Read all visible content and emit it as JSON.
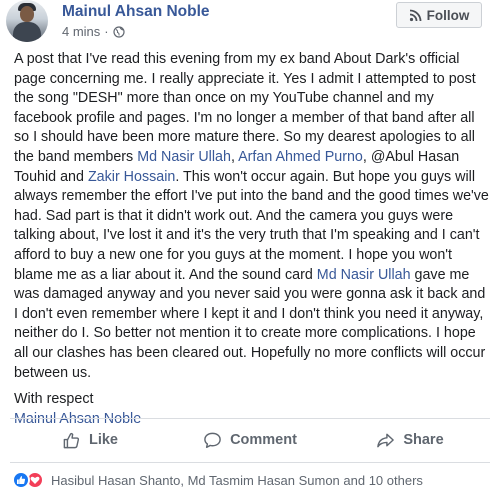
{
  "post": {
    "author": "Mainul Ahsan Noble",
    "timestamp": "4 mins",
    "separator": "·",
    "privacy_icon": "globe-icon",
    "follow_label": "Follow",
    "body": [
      {
        "type": "text",
        "value": "A post that I've read this evening from my ex band About Dark's official page concerning me. I really appreciate it. Yes I admit I attempted to post the song \"DESH\" more than once on my YouTube channel and my facebook profile and pages. I'm no longer a member of that band after all so I should have been more mature there. So my dearest apologies to all the band members "
      },
      {
        "type": "link",
        "value": "Md Nasir Ullah"
      },
      {
        "type": "text",
        "value": ", "
      },
      {
        "type": "link",
        "value": "Arfan Ahmed Purno"
      },
      {
        "type": "text",
        "value": ", @Abul Hasan Touhid and "
      },
      {
        "type": "link",
        "value": "Zakir Hossain"
      },
      {
        "type": "text",
        "value": ". This won't occur again. But hope you guys will always remember the effort I've put into the band and the good times we've had. Sad part is that it didn't work out. And the camera you guys were talking about, I've lost it and it's the very truth that I'm speaking and I can't afford to buy a new one for you guys at the moment. I hope you won't blame me as a liar about it. And the sound card "
      },
      {
        "type": "link",
        "value": "Md Nasir Ullah"
      },
      {
        "type": "text",
        "value": " gave me was damaged anyway and you never said you were gonna ask it back and I don't even remember where I kept it and I don't think you need it anyway, neither do I. So better not mention it to create more complications. I hope all our clashes has been cleared out. Hopefully no more conflicts will occur between us."
      }
    ],
    "signoff": "With respect",
    "signature": "Mainul Ahsan Noble"
  },
  "actions": {
    "like_label": "Like",
    "comment_label": "Comment",
    "share_label": "Share"
  },
  "reactions": {
    "icons": [
      "like-reaction-icon",
      "love-reaction-icon"
    ],
    "summary": "Hasibul Hasan Shanto, Md Tasmim Hasan Sumon and 10 others"
  },
  "colors": {
    "link": "#385898",
    "like_blue": "#1877f2",
    "love_red": "#f33e58",
    "muted": "#606770"
  }
}
